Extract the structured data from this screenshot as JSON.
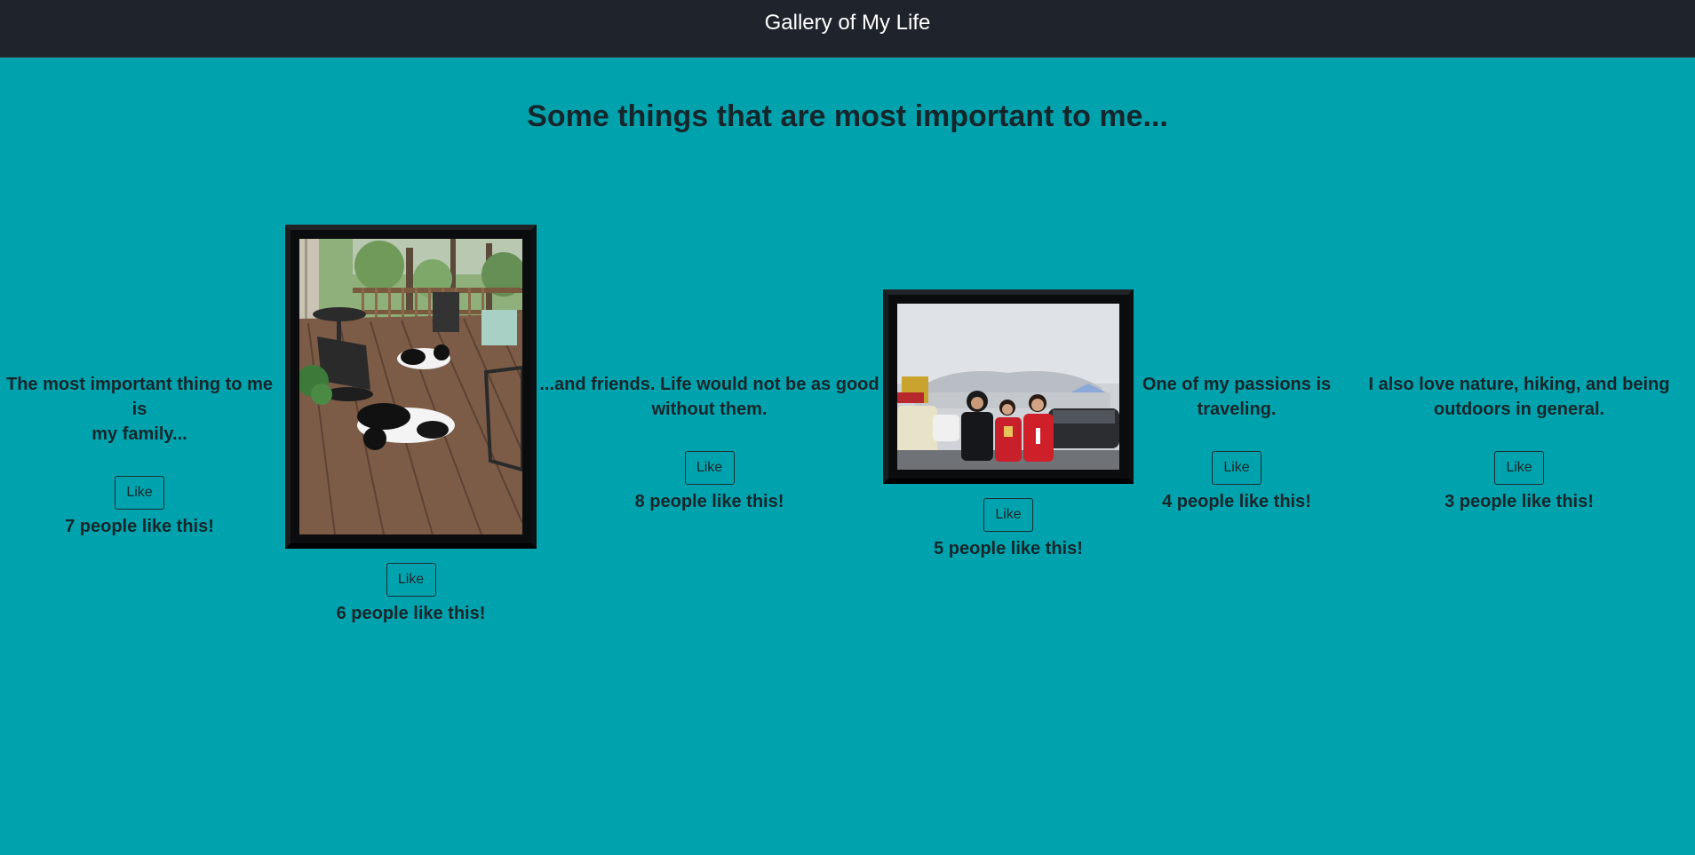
{
  "navbar": {
    "title": "Gallery of My Life"
  },
  "page": {
    "heading": "Some things that are most important to me..."
  },
  "cards": [
    {
      "caption_line1": "The most important thing to me is",
      "caption_line2": "my family...",
      "like_label": "Like",
      "likes_text": "7 people like this!"
    },
    {
      "image_subject": "dogs-on-deck-photo",
      "like_label": "Like",
      "likes_text": "6 people like this!"
    },
    {
      "caption_line1": "...and friends. Life would not be as good",
      "caption_line2": "without them.",
      "like_label": "Like",
      "likes_text": "8 people like this!"
    },
    {
      "image_subject": "friends-at-stadium-photo",
      "like_label": "Like",
      "likes_text": "5 people like this!"
    },
    {
      "caption_line1": "One of my passions is",
      "caption_line2": "traveling.",
      "like_label": "Like",
      "likes_text": "4 people like this!"
    },
    {
      "caption_line1": "I also love nature, hiking, and being",
      "caption_line2": "outdoors in general.",
      "like_label": "Like",
      "likes_text": "3 people like this!"
    }
  ],
  "colors": {
    "background": "#00a3ad",
    "navbar": "#1f232b",
    "text": "#14262b"
  }
}
